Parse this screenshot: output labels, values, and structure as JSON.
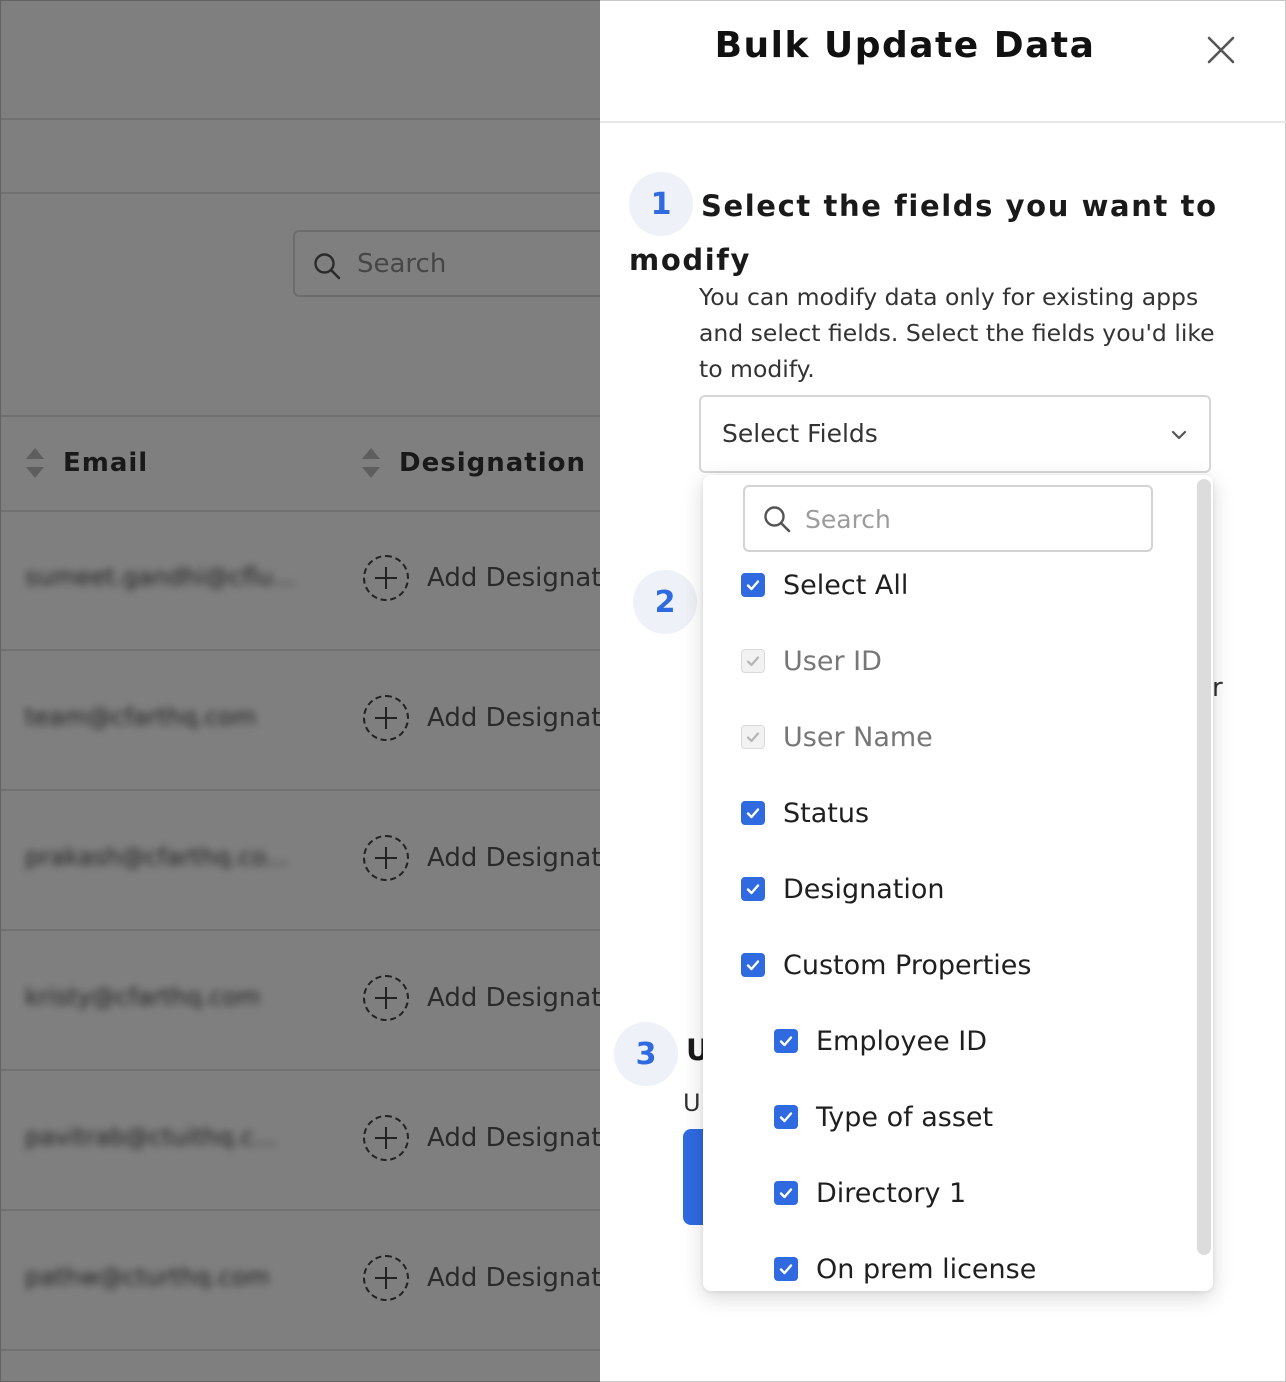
{
  "background": {
    "search_placeholder": "Search",
    "columns": {
      "email": "Email",
      "designation": "Designation"
    },
    "rows": [
      {
        "email": "sumeet.gandhi@cflu...",
        "action": "Add Designation"
      },
      {
        "email": "team@cfarthq.com",
        "action": "Add Designation"
      },
      {
        "email": "prakash@cfarthq.co...",
        "action": "Add Designation"
      },
      {
        "email": "kristy@cfarthq.com",
        "action": "Add Designation"
      },
      {
        "email": "pavitrab@ctuithq.c...",
        "action": "Add Designation"
      },
      {
        "email": "pathw@cturthq.com",
        "action": "Add Designation"
      }
    ]
  },
  "drawer": {
    "title": "Bulk Update Data",
    "step1": {
      "number": "1",
      "heading": "Select the fields you want to modify",
      "description": "You can modify data only for existing apps and select fields. Select the fields you'd like to modify.",
      "select_placeholder": "Select Fields"
    },
    "step2": {
      "number": "2",
      "partial_text": "r"
    },
    "step3": {
      "number": "3",
      "partial_title": "U",
      "partial_desc": "U"
    },
    "dropdown": {
      "search_placeholder": "Search",
      "options": [
        {
          "label": "Select All",
          "checked": true,
          "disabled": false,
          "indent": false
        },
        {
          "label": "User ID",
          "checked": true,
          "disabled": true,
          "indent": false
        },
        {
          "label": "User Name",
          "checked": true,
          "disabled": true,
          "indent": false
        },
        {
          "label": "Status",
          "checked": true,
          "disabled": false,
          "indent": false
        },
        {
          "label": "Designation",
          "checked": true,
          "disabled": false,
          "indent": false
        },
        {
          "label": "Custom Properties",
          "checked": true,
          "disabled": false,
          "indent": false
        },
        {
          "label": "Employee ID",
          "checked": true,
          "disabled": false,
          "indent": true
        },
        {
          "label": "Type of asset",
          "checked": true,
          "disabled": false,
          "indent": true
        },
        {
          "label": "Directory 1",
          "checked": true,
          "disabled": false,
          "indent": true
        },
        {
          "label": "On prem license",
          "checked": true,
          "disabled": false,
          "indent": true
        }
      ]
    }
  },
  "colors": {
    "accent": "#2f6ae0",
    "step_bg": "#eff1f8",
    "overlay": "rgba(0,0,0,0.5)"
  }
}
